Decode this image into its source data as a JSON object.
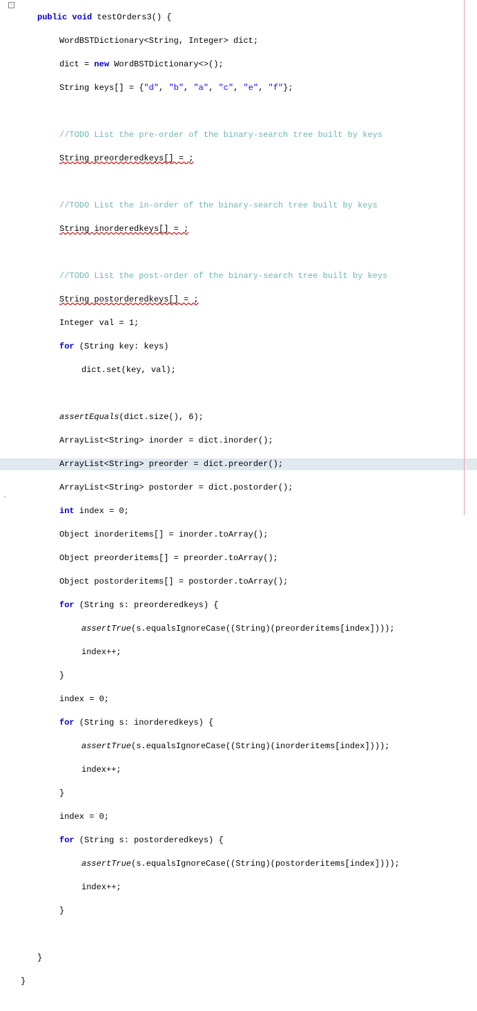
{
  "code": {
    "l0_kw_public": "public",
    "l0_kw_void": "void",
    "l0_method": " testOrders3() {",
    "l1_a": "WordBSTDictionary<String, Integer> dict;",
    "l2_a": "dict = ",
    "l2_kw_new": "new",
    "l2_b": " WordBSTDictionary<>();",
    "l3_a": "String keys[] = {",
    "l3_s1": "\"d\"",
    "l3_c1": ", ",
    "l3_s2": "\"b\"",
    "l3_c2": ", ",
    "l3_s3": "\"a\"",
    "l3_c3": ", ",
    "l3_s4": "\"c\"",
    "l3_c4": ", ",
    "l3_s5": "\"e\"",
    "l3_c5": ", ",
    "l3_s6": "\"f\"",
    "l3_end": "};",
    "l5_comm": "//TODO List the pre-order of the binary-search tree built by keys",
    "l6_err": "String preorderedkeys[] = ;",
    "l8_comm": "//TODO List the in-order of the binary-search tree built by keys",
    "l9_err": "String inorderedkeys[] = ;",
    "l11_comm": "//TODO List the post-order of the binary-search tree built by keys",
    "l12_err": "String postorderedkeys[] = ;",
    "l13": "Integer val = 1;",
    "l14_kw_for": "for",
    "l14_a": " (String key: keys)",
    "l15": "dict.set(key, val);",
    "l17_assert": "assertEquals",
    "l17_a": "(dict.size(), 6);",
    "l18": "ArrayList<String> inorder = dict.inorder();",
    "l19": "ArrayList<String> preorder = dict.preorder();",
    "l20": "ArrayList<String> postorder = dict.postorder();",
    "l21_kw_int": "int",
    "l21_a": " index = 0;",
    "l22": "Object inorderitems[] = inorder.toArray();",
    "l23": "Object preorderitems[] = preorder.toArray();",
    "l24": "Object postorderitems[] = postorder.toArray();",
    "l25_kw_for": "for",
    "l25_a": " (String s: preorderedkeys) {",
    "l26_assert": "assertTrue",
    "l26_a": "(s.equalsIgnoreCase((String)(preorderitems[index])));",
    "l27": "index++;",
    "l28": "}",
    "l29": "index = 0;",
    "l30_kw_for": "for",
    "l30_a": " (String s: inorderedkeys) {",
    "l31_assert": "assertTrue",
    "l31_a": "(s.equalsIgnoreCase((String)(inorderitems[index])));",
    "l32": "index++;",
    "l33": "}",
    "l34": "index = 0;",
    "l35_kw_for": "for",
    "l35_a": " (String s: postorderedkeys) {",
    "l36_assert": "assertTrue",
    "l36_a": "(s.equalsIgnoreCase((String)(postorderitems[index])));",
    "l37": "index++;",
    "l38": "}",
    "l40": "}",
    "l41": "}",
    "fold_sym": "-"
  }
}
